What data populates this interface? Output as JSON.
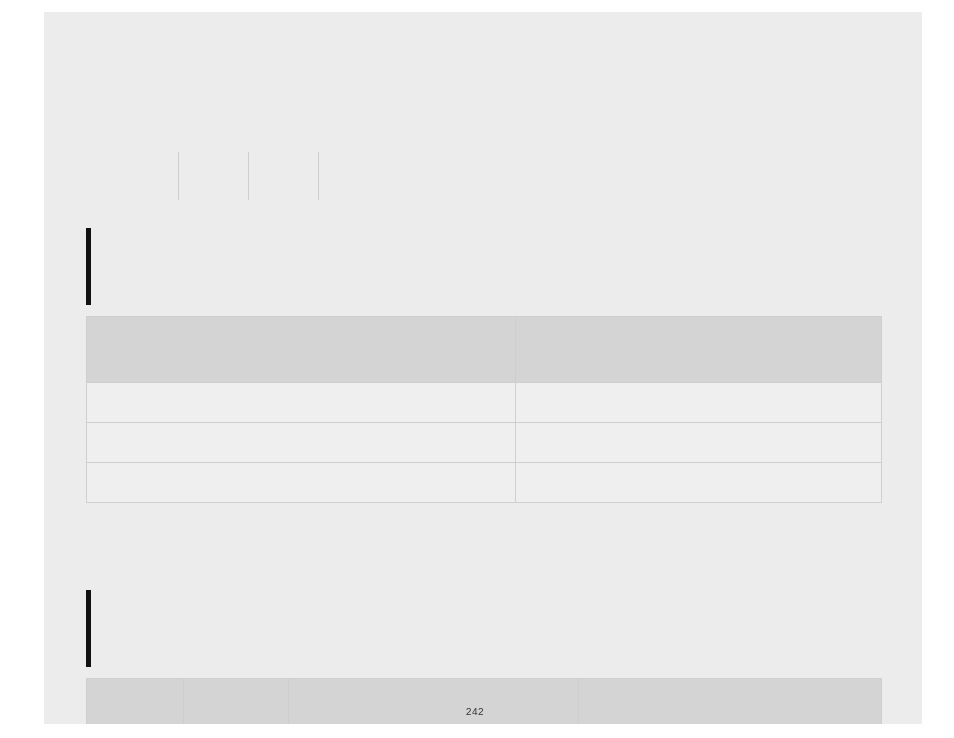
{
  "pageNumber": "242",
  "table1": {
    "headers": [
      "",
      ""
    ],
    "rows": [
      [
        "",
        ""
      ],
      [
        "",
        ""
      ],
      [
        "",
        ""
      ]
    ]
  },
  "table2": {
    "headers": [
      "",
      "",
      "",
      ""
    ]
  }
}
